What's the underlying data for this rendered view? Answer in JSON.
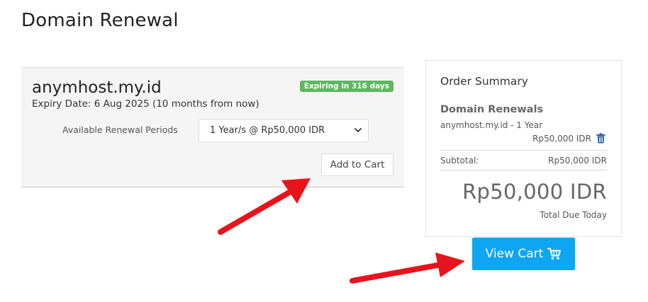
{
  "page": {
    "title": "Domain Renewal"
  },
  "renewal": {
    "domain": "anymhost.my.id",
    "expiry_text": "Expiry Date: 6 Aug 2025 (10 months from now)",
    "badge": "Expiring in 316 days",
    "period_label": "Available Renewal Periods",
    "period_selected": "1 Year/s @ Rp50,000 IDR",
    "add_to_cart_label": "Add to Cart"
  },
  "summary": {
    "title": "Order Summary",
    "section_title": "Domain Renewals",
    "item_desc": "anymhost.my.id - 1 Year",
    "item_price": "Rp50,000 IDR",
    "subtotal_label": "Subtotal:",
    "subtotal_value": "Rp50,000 IDR",
    "total_amount": "Rp50,000 IDR",
    "total_label": "Total Due Today"
  },
  "view_cart_label": "View Cart",
  "colors": {
    "badge_green": "#5cb85c",
    "primary_button": "#0ea5f3",
    "trash_icon": "#1f5fa8",
    "annotation_arrow": "#e8131b"
  },
  "icons": [
    "chevron-down-icon",
    "trash-icon",
    "cart-icon",
    "annotation-arrow"
  ]
}
